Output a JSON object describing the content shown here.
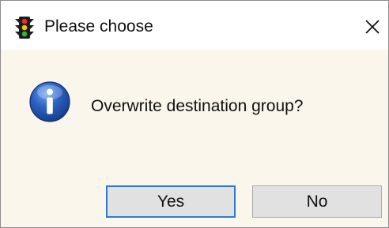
{
  "window": {
    "title": "Please choose",
    "icon": "traffic-light-icon",
    "close_icon": "close-icon"
  },
  "message": {
    "icon": "information-icon",
    "text": "Overwrite destination group?"
  },
  "buttons": {
    "yes_label": "Yes",
    "no_label": "No",
    "default": "Yes"
  },
  "colors": {
    "title_bg": "#ffffff",
    "dialog_bg": "#fbf6ec",
    "button_bg": "#e1e1e1",
    "focus_border": "#2b7bd0",
    "info_icon": "#1f4fa6"
  }
}
